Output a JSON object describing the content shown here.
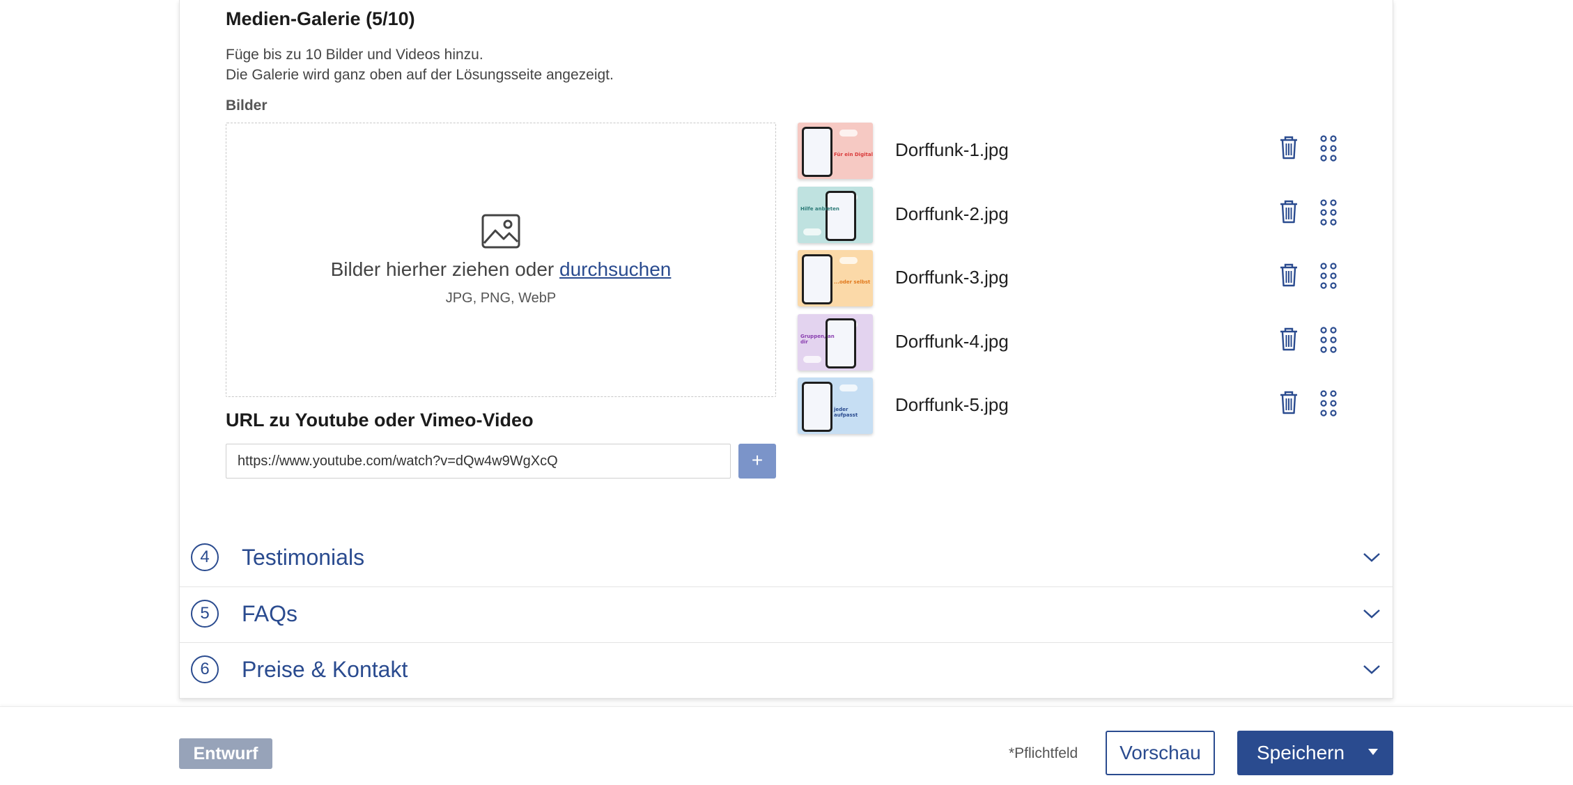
{
  "gallery": {
    "title": "Medien-Galerie (5/10)",
    "description_line1": "Füge bis zu 10 Bilder und Videos hinzu.",
    "description_line2": "Die Galerie wird ganz oben auf der Lösungsseite angezeigt.",
    "images_label": "Bilder",
    "dropzone": {
      "icon": "image-icon",
      "text": "Bilder hierher ziehen oder ",
      "link": "durchsuchen",
      "formats": "JPG, PNG, WebP"
    },
    "files": [
      {
        "name": "Dorffunk-1.jpg",
        "thumb_color": "#f6c9c3",
        "thumb_text": "Für ein Digital",
        "accent": "#d93a3a"
      },
      {
        "name": "Dorffunk-2.jpg",
        "thumb_color": "#bfe2e0",
        "thumb_text": "Hilfe anbieten",
        "accent": "#2b7a77"
      },
      {
        "name": "Dorffunk-3.jpg",
        "thumb_color": "#fbd9a8",
        "thumb_text": "...oder selbst",
        "accent": "#e07a1f"
      },
      {
        "name": "Dorffunk-4.jpg",
        "thumb_color": "#e3d3ef",
        "thumb_text": "Gruppen, an dir",
        "accent": "#8a3fb0"
      },
      {
        "name": "Dorffunk-5.jpg",
        "thumb_color": "#c6def3",
        "thumb_text": "jeder aufpasst",
        "accent": "#2a4b8f"
      }
    ],
    "file_actions": {
      "delete_icon": "trash-icon",
      "drag_icon": "drag-handle-icon"
    }
  },
  "video": {
    "title": "URL zu Youtube oder Vimeo-Video",
    "value": "https://www.youtube.com/watch?v=dQw4w9WgXcQ",
    "add_label": "+"
  },
  "accordion": [
    {
      "number": "4",
      "title": "Testimonials"
    },
    {
      "number": "5",
      "title": "FAQs"
    },
    {
      "number": "6",
      "title": "Preise & Kontakt"
    }
  ],
  "footer": {
    "status": "Entwurf",
    "required_note": "*Pflichtfeld",
    "preview_label": "Vorschau",
    "save_label": "Speichern"
  },
  "colors": {
    "primary": "#2a4b8f",
    "add_button": "#7b94c9",
    "draft_badge": "#97a3b9"
  }
}
